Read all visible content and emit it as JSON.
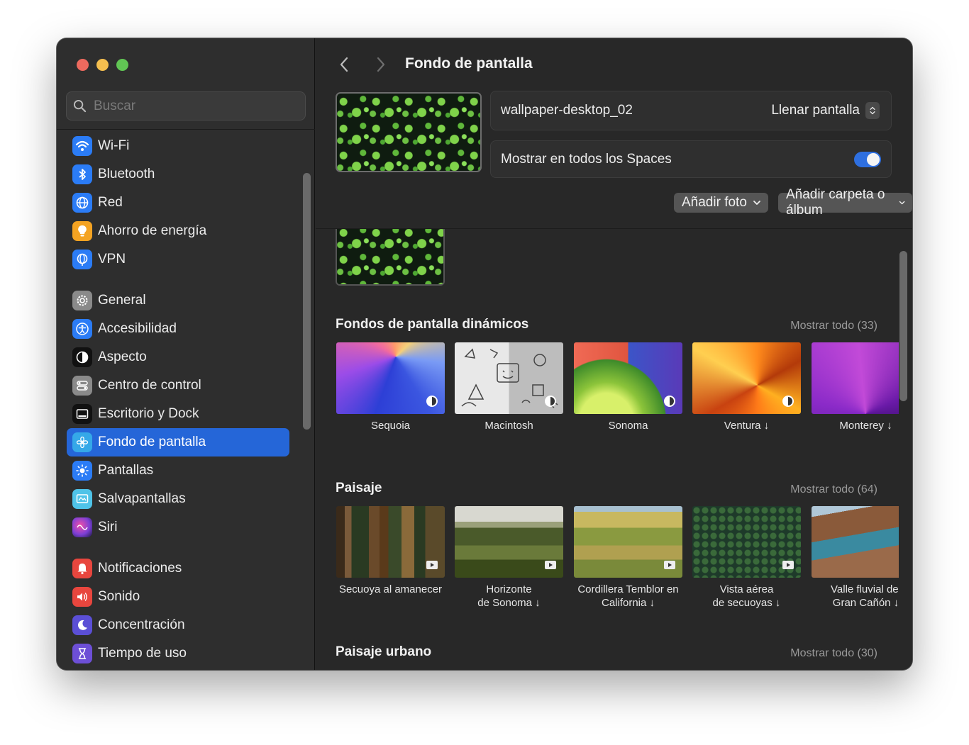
{
  "window": {
    "traffic_lights": [
      "close",
      "minimize",
      "zoom"
    ]
  },
  "search": {
    "placeholder": "Buscar"
  },
  "sidebar": {
    "items": [
      {
        "label": "Wi-Fi",
        "icon": "wifi-icon",
        "color": "#2b7cf6"
      },
      {
        "label": "Bluetooth",
        "icon": "bluetooth-icon",
        "color": "#2b7cf6"
      },
      {
        "label": "Red",
        "icon": "globe-icon",
        "color": "#2b7cf6"
      },
      {
        "label": "Ahorro de energía",
        "icon": "lightbulb-icon",
        "color": "#f4a322"
      },
      {
        "label": "VPN",
        "icon": "vpn-globe-icon",
        "color": "#2b7cf6"
      },
      {
        "label": "General",
        "icon": "gear-icon",
        "color": "#8a8a8a"
      },
      {
        "label": "Accesibilidad",
        "icon": "accessibility-icon",
        "color": "#2b7cf6"
      },
      {
        "label": "Aspecto",
        "icon": "appearance-icon",
        "color": "#111111"
      },
      {
        "label": "Centro de control",
        "icon": "control-center-icon",
        "color": "#8a8a8a"
      },
      {
        "label": "Escritorio y Dock",
        "icon": "dock-icon",
        "color": "#111111"
      },
      {
        "label": "Fondo de pantalla",
        "icon": "wallpaper-icon",
        "color": "#35a8e8"
      },
      {
        "label": "Pantallas",
        "icon": "sun-icon",
        "color": "#2b7cf6"
      },
      {
        "label": "Salvapantallas",
        "icon": "screensaver-icon",
        "color": "#4fc3e8"
      },
      {
        "label": "Siri",
        "icon": "siri-icon",
        "color": "#7d3fd6"
      },
      {
        "label": "Notificaciones",
        "icon": "bell-icon",
        "color": "#e8463e"
      },
      {
        "label": "Sonido",
        "icon": "speaker-icon",
        "color": "#e8463e"
      },
      {
        "label": "Concentración",
        "icon": "moon-icon",
        "color": "#5b4fd6"
      },
      {
        "label": "Tiempo de uso",
        "icon": "hourglass-icon",
        "color": "#6d4fd6"
      }
    ],
    "active": "Fondo de pantalla"
  },
  "header": {
    "title": "Fondo de pantalla"
  },
  "current": {
    "filename": "wallpaper-desktop_02",
    "fit_mode": "Llenar pantalla",
    "spaces_label": "Mostrar en todos los Spaces",
    "spaces_on": true
  },
  "buttons": {
    "add_photo": "Añadir foto",
    "add_folder": "Añadir carpeta o álbum"
  },
  "sections": {
    "dynamic": {
      "title": "Fondos de pantalla dinámicos",
      "show_all": "Mostrar todo (33)",
      "tiles": [
        {
          "caption": "Sequoia"
        },
        {
          "caption": "Macintosh"
        },
        {
          "caption": "Sonoma"
        },
        {
          "caption": "Ventura ↓"
        },
        {
          "caption": "Monterey ↓"
        }
      ]
    },
    "landscape": {
      "title": "Paisaje",
      "show_all": "Mostrar todo (64)",
      "tiles": [
        {
          "caption": "Secuoya al amanecer"
        },
        {
          "caption": "Horizonte\nde Sonoma ↓"
        },
        {
          "caption": "Cordillera Temblor en\nCalifornia ↓"
        },
        {
          "caption": "Vista aérea\nde secuoyas ↓"
        },
        {
          "caption": "Valle fluvial del\nGran Cañón ↓"
        }
      ]
    },
    "urban": {
      "title": "Paisaje urbano",
      "show_all": "Mostrar todo (30)"
    }
  },
  "colors": {
    "accent": "#2566d8",
    "window_bg": "#282828",
    "sidebar_bg": "#2e2e2e"
  }
}
